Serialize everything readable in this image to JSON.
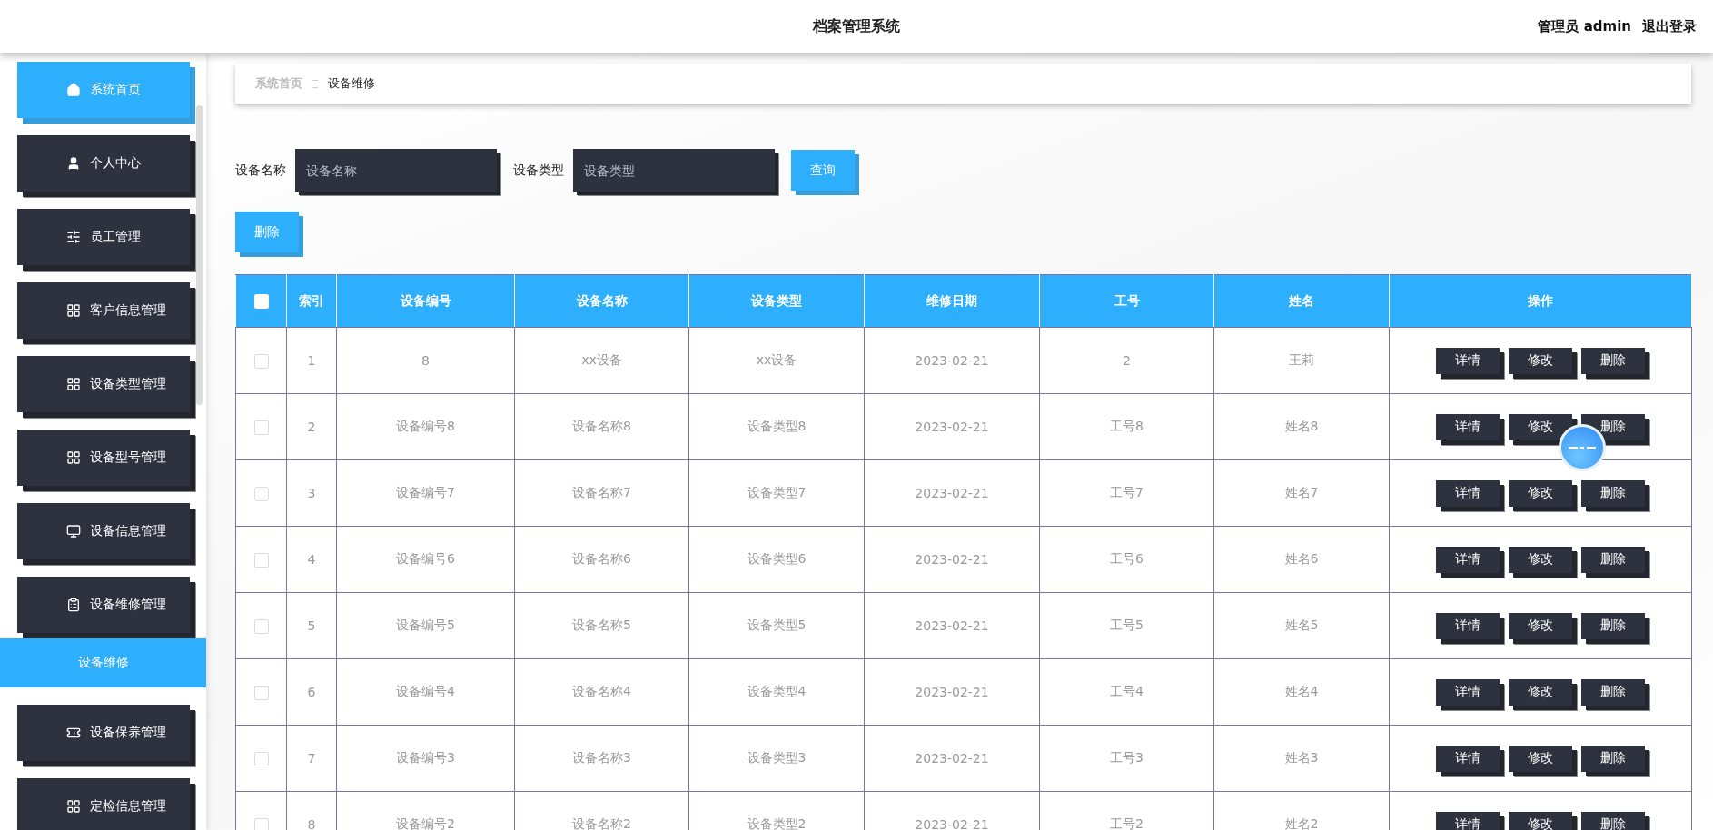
{
  "header": {
    "title": "档案管理系统",
    "user": "管理员 admin",
    "logout": "退出登录"
  },
  "sidebar": {
    "items": [
      {
        "label": "系统首页",
        "selected": true
      },
      {
        "label": "个人中心",
        "selected": false
      },
      {
        "label": "员工管理",
        "selected": false
      },
      {
        "label": "客户信息管理",
        "selected": false
      },
      {
        "label": "设备类型管理",
        "selected": false
      },
      {
        "label": "设备型号管理",
        "selected": false
      },
      {
        "label": "设备信息管理",
        "selected": false
      },
      {
        "label": "设备维修管理",
        "selected": false,
        "children": [
          {
            "label": "设备维修",
            "selected": true
          }
        ]
      },
      {
        "label": "设备保养管理",
        "selected": false
      },
      {
        "label": "定检信息管理",
        "selected": false
      }
    ]
  },
  "breadcrumb": {
    "items": [
      "系统首页",
      "设备维修"
    ],
    "separator": "Ξ"
  },
  "search": {
    "fields": [
      {
        "label": "设备名称",
        "placeholder": "设备名称"
      },
      {
        "label": "设备类型",
        "placeholder": "设备类型"
      }
    ],
    "button": "查询"
  },
  "delete_button": "删除",
  "table": {
    "all_checked": false,
    "columns": [
      "索引",
      "设备编号",
      "设备名称",
      "设备类型",
      "维修日期",
      "工号",
      "姓名",
      "操作"
    ],
    "rows": [
      {
        "checked": false,
        "cells": [
          "1",
          "8",
          "xx设备",
          "xx设备",
          "2023-02-21",
          "2",
          "王莉"
        ],
        "actions": [
          "详情",
          "修改",
          "删除"
        ]
      },
      {
        "checked": false,
        "cells": [
          "2",
          "设备编号8",
          "设备名称8",
          "设备类型8",
          "2023-02-21",
          "工号8",
          "姓名8"
        ],
        "actions": [
          "详情",
          "修改",
          "删除"
        ]
      },
      {
        "checked": false,
        "cells": [
          "3",
          "设备编号7",
          "设备名称7",
          "设备类型7",
          "2023-02-21",
          "工号7",
          "姓名7"
        ],
        "actions": [
          "详情",
          "修改",
          "删除"
        ]
      },
      {
        "checked": false,
        "cells": [
          "4",
          "设备编号6",
          "设备名称6",
          "设备类型6",
          "2023-02-21",
          "工号6",
          "姓名6"
        ],
        "actions": [
          "详情",
          "修改",
          "删除"
        ]
      },
      {
        "checked": false,
        "cells": [
          "5",
          "设备编号5",
          "设备名称5",
          "设备类型5",
          "2023-02-21",
          "工号5",
          "姓名5"
        ],
        "actions": [
          "详情",
          "修改",
          "删除"
        ]
      },
      {
        "checked": false,
        "cells": [
          "6",
          "设备编号4",
          "设备名称4",
          "设备类型4",
          "2023-02-21",
          "工号4",
          "姓名4"
        ],
        "actions": [
          "详情",
          "修改",
          "删除"
        ]
      },
      {
        "checked": false,
        "cells": [
          "7",
          "设备编号3",
          "设备名称3",
          "设备类型3",
          "2023-02-21",
          "工号3",
          "姓名3"
        ],
        "actions": [
          "详情",
          "修改",
          "删除"
        ]
      },
      {
        "checked": false,
        "cells": [
          "8",
          "设备编号2",
          "设备名称2",
          "设备类型2",
          "2023-02-21",
          "工号2",
          "姓名2"
        ],
        "actions": [
          "详情",
          "修改",
          "删除"
        ]
      }
    ]
  }
}
